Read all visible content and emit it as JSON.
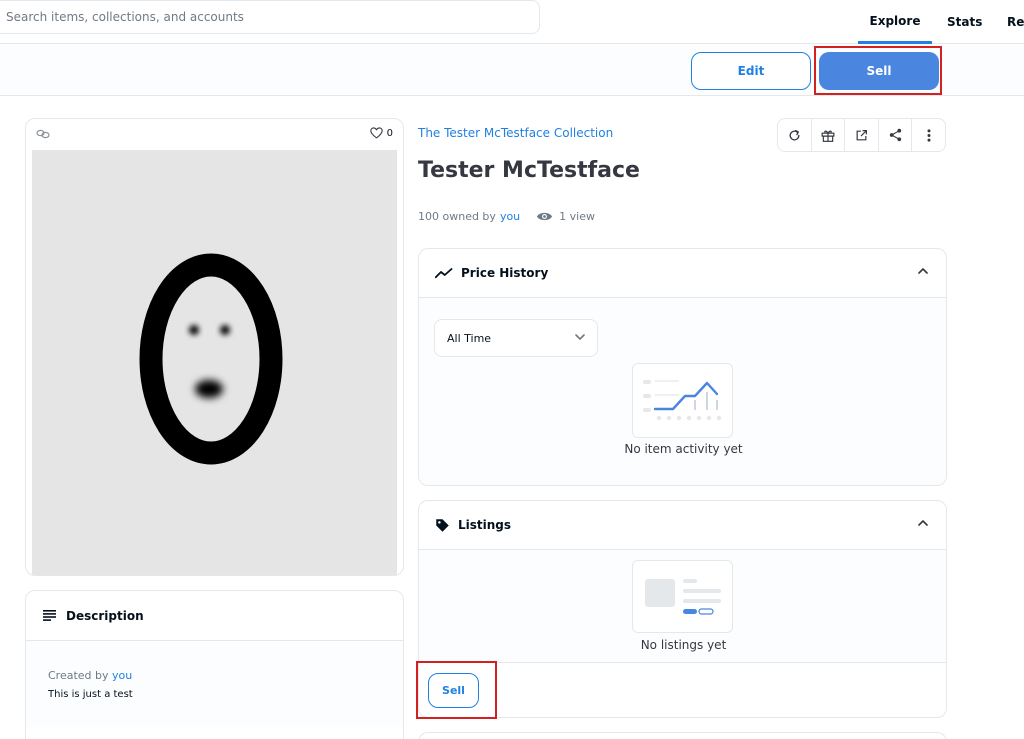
{
  "header": {
    "search_placeholder": "Search items, collections, and accounts",
    "nav": [
      {
        "label": "Explore",
        "active": true
      },
      {
        "label": "Stats"
      },
      {
        "label": "Res"
      }
    ]
  },
  "actions": {
    "edit_label": "Edit",
    "sell_label": "Sell"
  },
  "item": {
    "favorites": "0",
    "collection": "The Tester McTestface Collection",
    "name": "Tester McTestface",
    "owned_prefix": "100 owned by",
    "owner": "you",
    "views": "1 view"
  },
  "description": {
    "heading": "Description",
    "created_prefix": "Created by",
    "creator": "you",
    "text": "This is just a test"
  },
  "price_history": {
    "heading": "Price History",
    "range_selected": "All Time",
    "empty": "No item activity yet"
  },
  "listings": {
    "heading": "Listings",
    "empty": "No listings yet",
    "sell_label": "Sell"
  },
  "colors": {
    "accent": "#2081e2",
    "sell_fill": "#4a86e0",
    "highlight": "#d32020"
  }
}
